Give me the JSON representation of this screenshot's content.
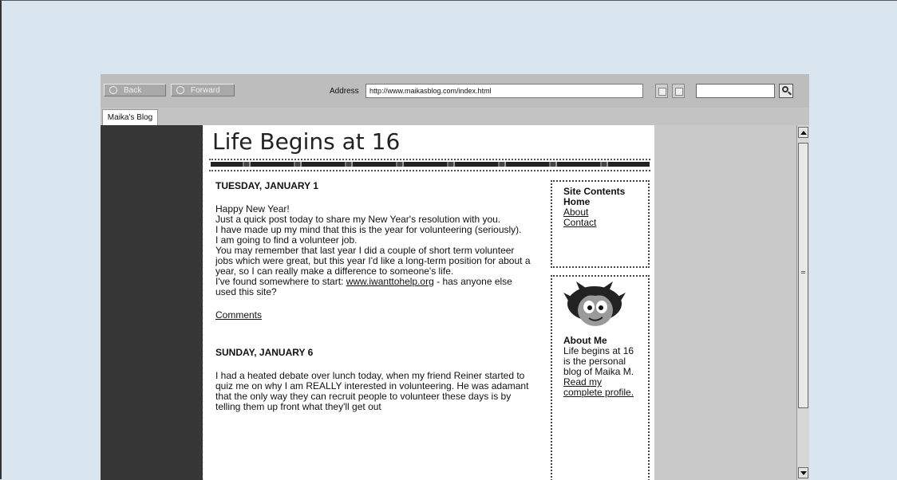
{
  "browser": {
    "back_label": "Back",
    "forward_label": "Forward",
    "address_label": "Address",
    "address_value": "http://www.maikasblog.com/index.html",
    "search_value": "",
    "tab_label": "Maika's Blog"
  },
  "blog": {
    "title": "Life Begins at 16",
    "posts": [
      {
        "date": "TUESDAY, JANUARY 1",
        "lines": [
          "Happy New Year!",
          "Just a quick post today to share my New Year's resolution with you.",
          "I have made up my mind that this is the year for volunteering (seriously).",
          "I am going to find a volunteer job.",
          "You may remember that last year I did a couple of short term volunteer jobs which were great, but this year I'd like a long-term position for about a year, so I can really make a difference to someone's life."
        ],
        "link_prefix": "I've found somewhere to start: ",
        "link_text": "www.iwanttohelp.org",
        "link_suffix": " - has anyone else used this site?",
        "comments_label": "Comments"
      },
      {
        "date": "SUNDAY, JANUARY 6",
        "body": "I had a heated debate over lunch today, when my friend Reiner started to quiz me on why I am REALLY interested in volunteering. He was adamant that the only way they can recruit people to volunteer these days is by telling them up front what they'll get out"
      }
    ],
    "sidebar": {
      "contents_title": "Site Contents",
      "nav": [
        "Home",
        "About",
        "Contact"
      ],
      "about_title": "About Me",
      "about_text": "Life begins at 16 is the personal blog of Maika M.",
      "profile_link": "Read my complete profile."
    }
  },
  "icons": [
    "back-arrow-icon",
    "forward-arrow-icon",
    "page-icon",
    "bookmark-icon",
    "search-icon",
    "scroll-up-icon",
    "scroll-down-icon",
    "avatar-illustration"
  ]
}
